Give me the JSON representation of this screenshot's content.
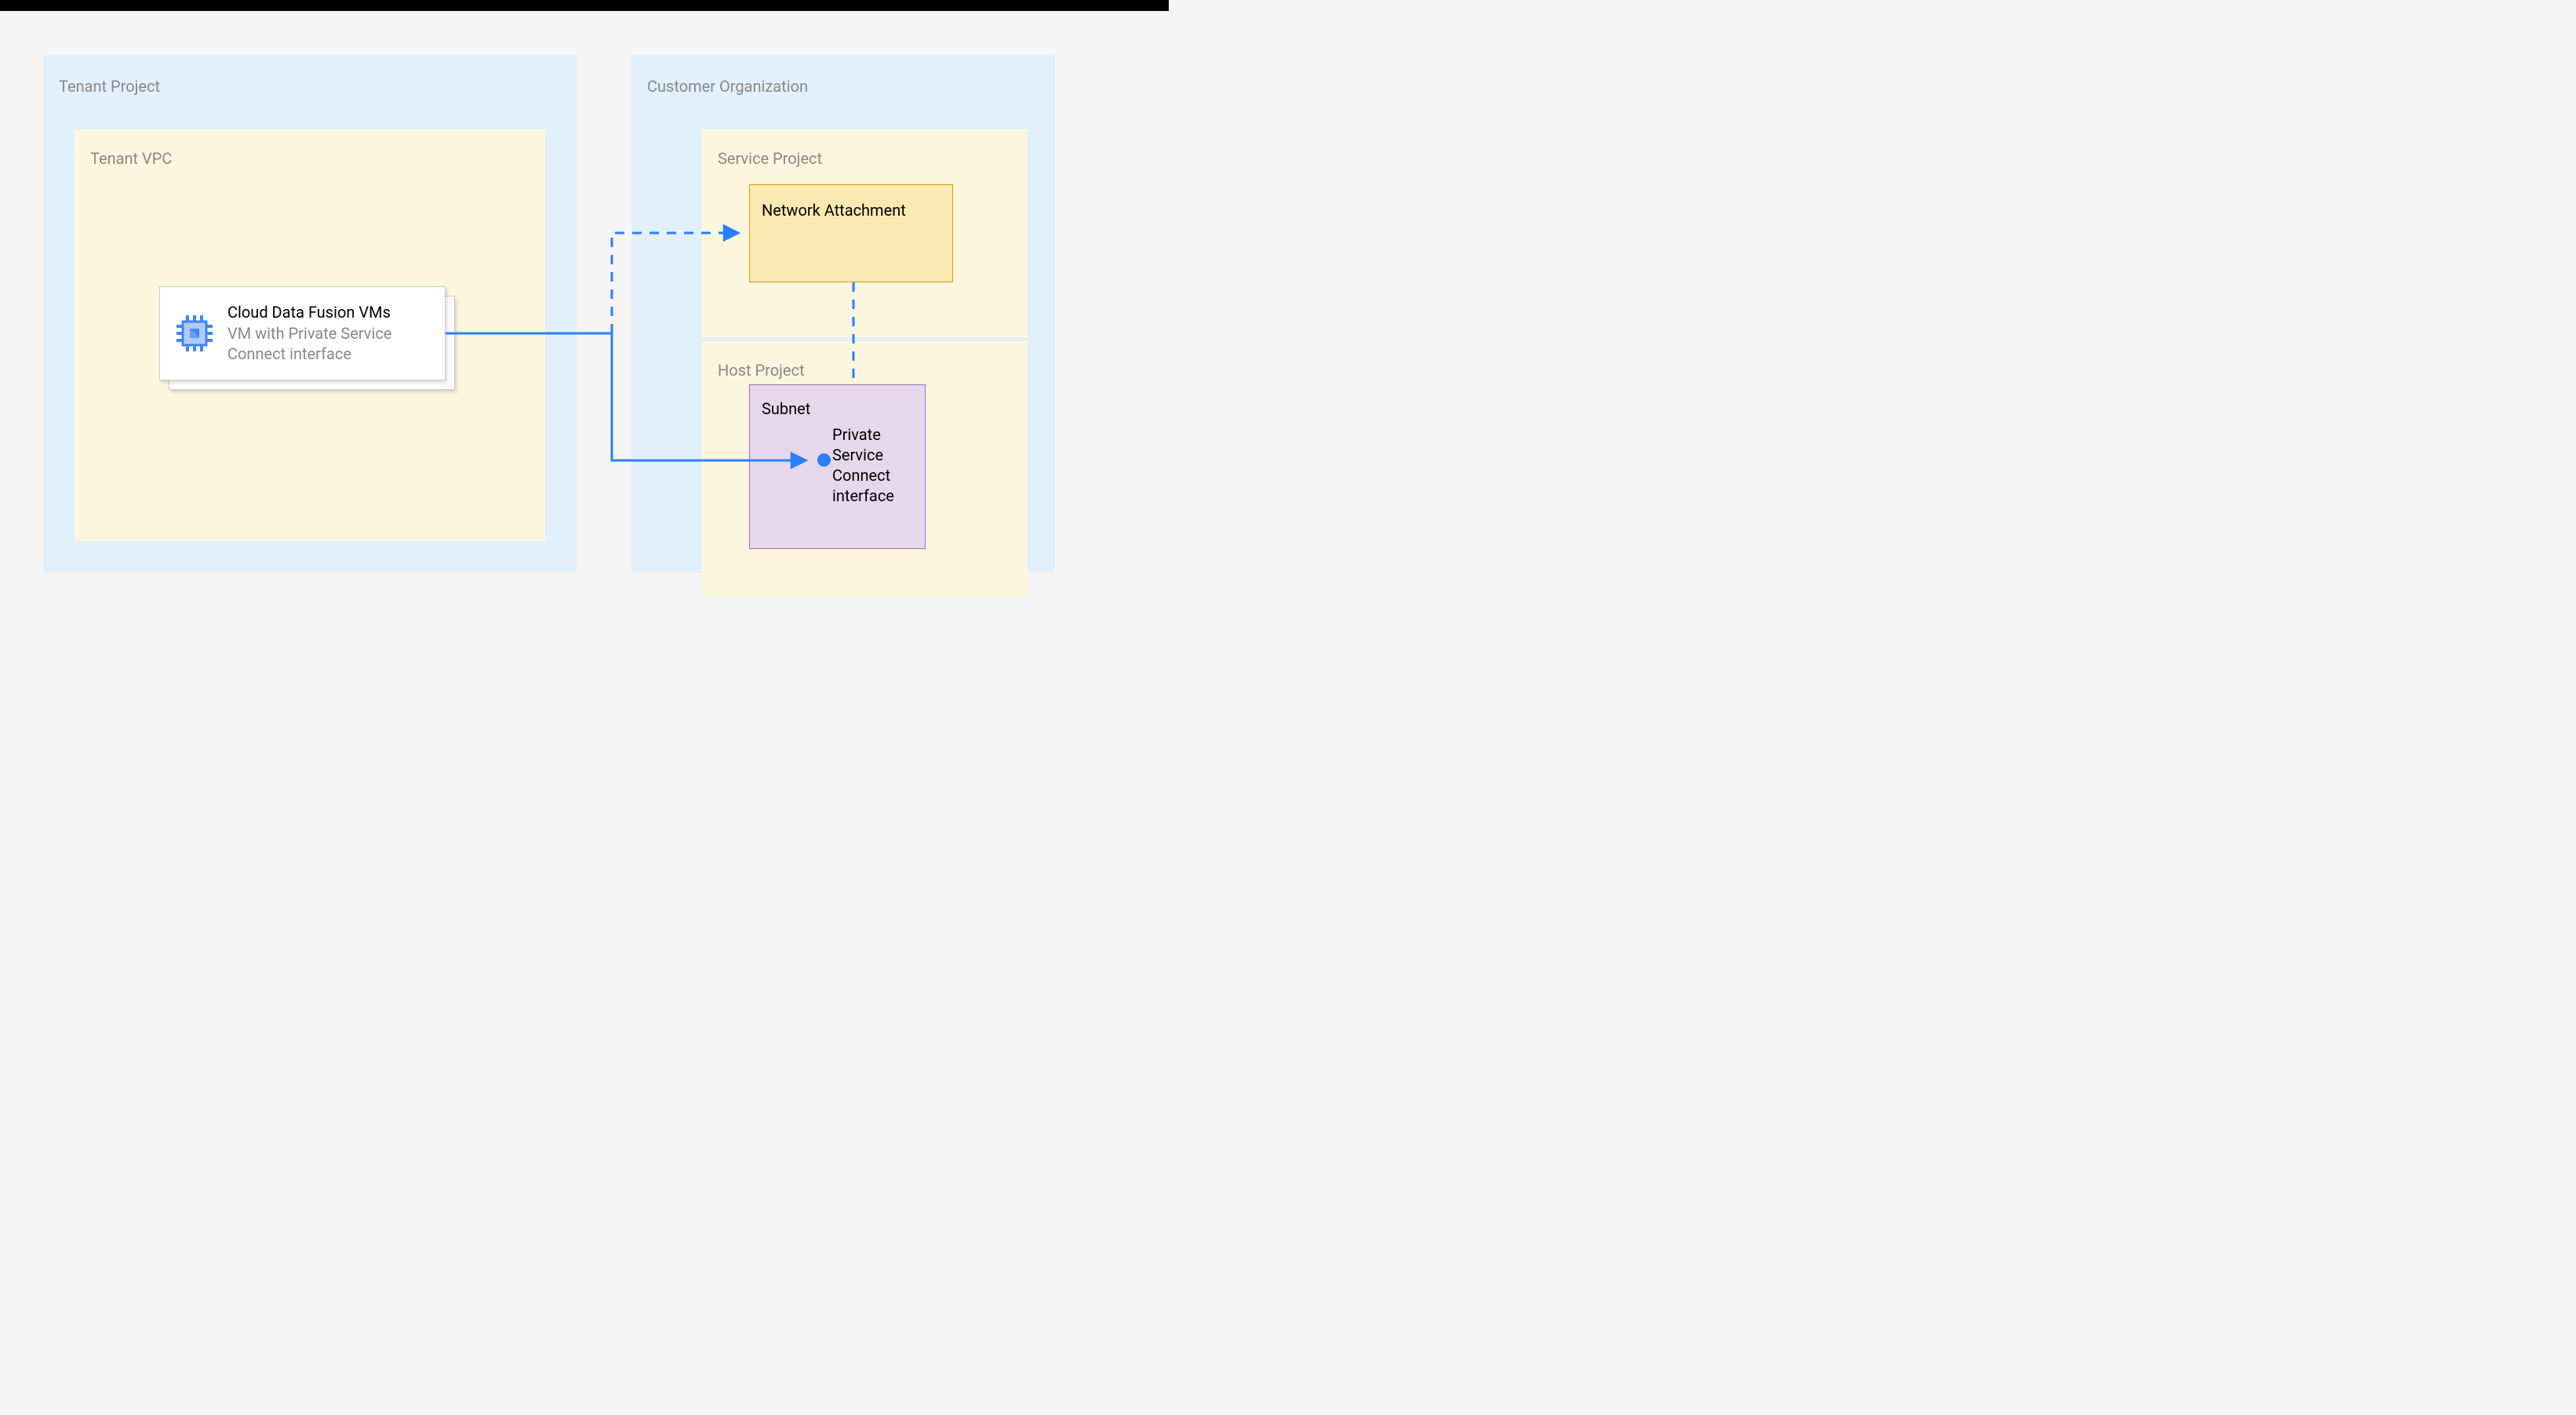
{
  "diagram": {
    "tenant_project": {
      "label": "Tenant Project",
      "vpc": {
        "label": "Tenant VPC",
        "vm": {
          "title": "Cloud Data Fusion VMs",
          "subtitle": "VM with Private Service Connect interface"
        }
      }
    },
    "customer_org": {
      "label": "Customer Organization",
      "service_project": {
        "label": "Service Project",
        "network_attachment": {
          "label": "Network Attachment"
        }
      },
      "host_project": {
        "label": "Host Project",
        "subnet": {
          "label": "Subnet",
          "psc_interface": "Private Service Connect interface"
        }
      }
    },
    "colors": {
      "outer_container": "#e1f0fb",
      "inner_yellow": "#fdf6df",
      "network_attachment_fill": "#fce8b2",
      "network_attachment_border": "#d89a00",
      "subnet_fill": "#e6d7eb",
      "subnet_border": "#a86bb8",
      "connector_blue": "#2a7fff"
    }
  }
}
